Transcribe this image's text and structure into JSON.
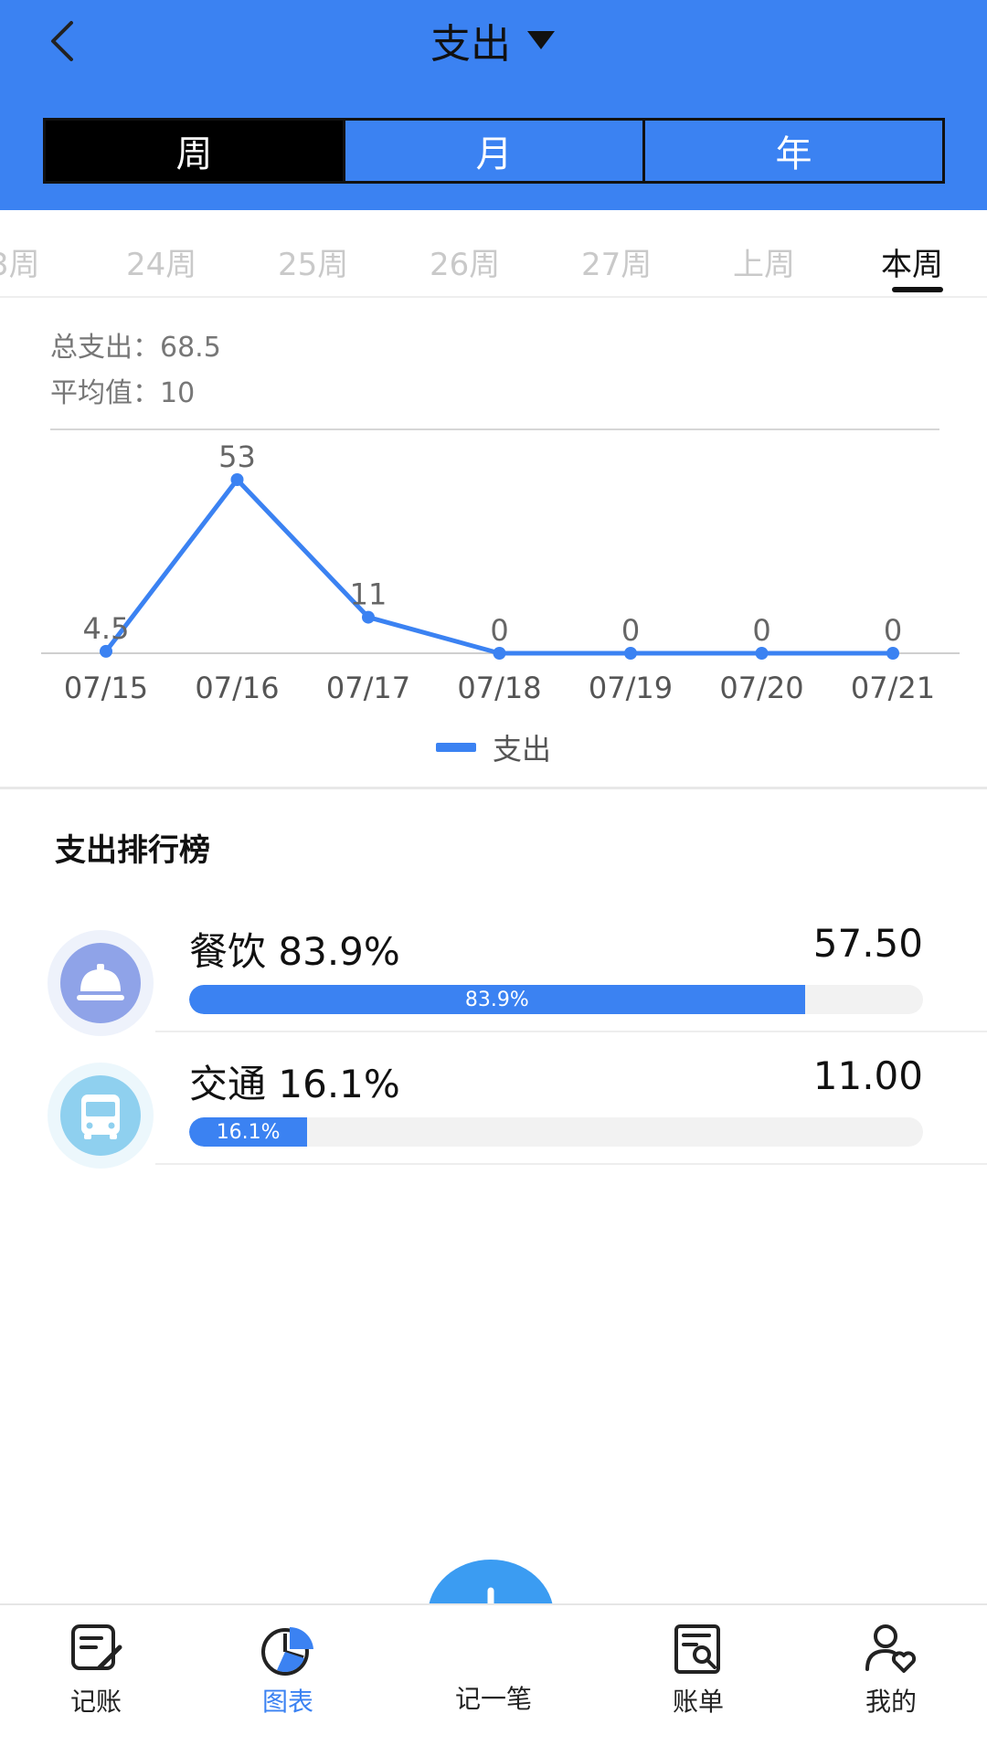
{
  "header": {
    "title": "支出",
    "segments": [
      {
        "label": "周",
        "active": true
      },
      {
        "label": "月",
        "active": false
      },
      {
        "label": "年",
        "active": false
      }
    ]
  },
  "weeks": {
    "items": [
      "3周",
      "24周",
      "25周",
      "26周",
      "27周",
      "上周",
      "本周"
    ],
    "active_index": 6
  },
  "summary": {
    "total_label": "总支出：",
    "total_value": "68.5",
    "avg_label": "平均值：",
    "avg_value": "10"
  },
  "chart_data": {
    "type": "line",
    "categories": [
      "07/15",
      "07/16",
      "07/17",
      "07/18",
      "07/19",
      "07/20",
      "07/21"
    ],
    "series": [
      {
        "name": "支出",
        "values": [
          4.5,
          53,
          11,
          0,
          0,
          0,
          0
        ],
        "color": "#3b82f2"
      }
    ],
    "data_labels": [
      "4.5",
      "53",
      "11",
      "0",
      "0",
      "0",
      "0"
    ],
    "ylim": [
      0,
      60
    ],
    "legend": "bottom-center"
  },
  "ranking": {
    "title": "支出排行榜",
    "items": [
      {
        "name": "餐饮",
        "percent_text": "83.9%",
        "amount": "57.50",
        "percent": 83.9,
        "icon": "dining-bell-icon",
        "icon_color": "#8fa3e8",
        "icon_bg": "#eef2fb"
      },
      {
        "name": "交通",
        "percent_text": "16.1%",
        "amount": "11.00",
        "percent": 16.1,
        "icon": "bus-icon",
        "icon_color": "#8fd0ef",
        "icon_bg": "#ecf7fc"
      }
    ]
  },
  "tabbar": {
    "tabs": [
      {
        "label": "记账",
        "icon": "notebook-pen-icon"
      },
      {
        "label": "图表",
        "icon": "pie-chart-icon"
      },
      {
        "label": "记一笔",
        "icon": "plus-icon"
      },
      {
        "label": "账单",
        "icon": "bill-search-icon"
      },
      {
        "label": "我的",
        "icon": "user-heart-icon"
      }
    ],
    "active_index": 1
  },
  "colors": {
    "accent": "#3b82f2",
    "fab": "#3b9cf2"
  }
}
